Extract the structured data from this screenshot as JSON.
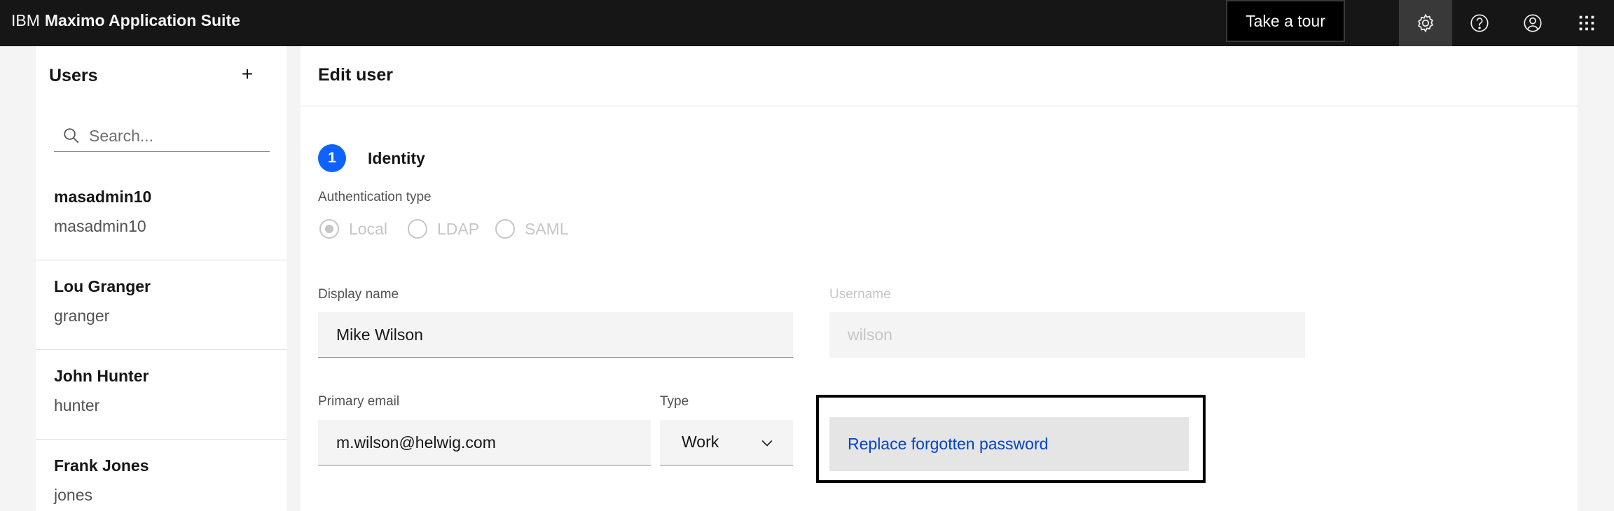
{
  "header": {
    "brand_prefix": "IBM",
    "brand_name": "Maximo Application Suite",
    "tour_label": "Take a tour",
    "icons": [
      "settings-icon",
      "help-icon",
      "user-profile-icon",
      "app-switcher-icon"
    ]
  },
  "users_panel": {
    "title": "Users",
    "add_label": "+",
    "search_placeholder": "Search...",
    "users": [
      {
        "name": "masadmin10",
        "id": "masadmin10"
      },
      {
        "name": "Lou Granger",
        "id": "granger"
      },
      {
        "name": "John Hunter",
        "id": "hunter"
      },
      {
        "name": "Frank Jones",
        "id": "jones"
      }
    ]
  },
  "edit_user": {
    "title": "Edit user",
    "step_number": "1",
    "step_label": "Identity",
    "auth_type_label": "Authentication type",
    "auth_options": [
      "Local",
      "LDAP",
      "SAML"
    ],
    "auth_selected": "Local",
    "display_name_label": "Display name",
    "display_name_value": "Mike Wilson",
    "username_label": "Username",
    "username_value": "wilson",
    "primary_email_label": "Primary email",
    "primary_email_value": "m.wilson@helwig.com",
    "type_label": "Type",
    "type_value": "Work",
    "replace_password_label": "Replace forgotten password"
  },
  "colors": {
    "header_bg": "#161616",
    "accent_blue": "#0f62fe",
    "link_blue": "#0043ce",
    "field_bg": "#f4f4f4"
  }
}
